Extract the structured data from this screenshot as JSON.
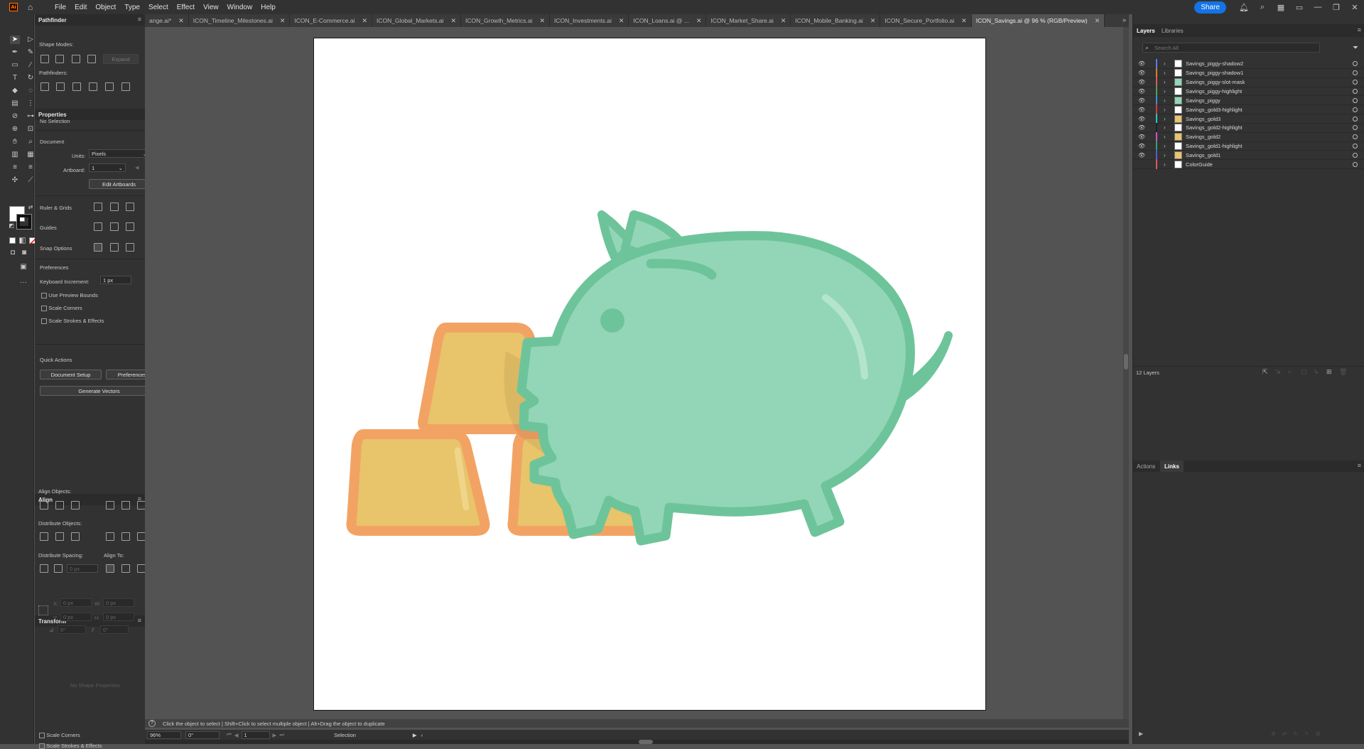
{
  "menubar": {
    "logo": "Ai",
    "items": [
      "File",
      "Edit",
      "Object",
      "Type",
      "Select",
      "Effect",
      "View",
      "Window",
      "Help"
    ],
    "share_label": "Share"
  },
  "tabs": [
    {
      "label": "ange.ai*",
      "active": false
    },
    {
      "label": "ICON_Timeline_Milestones.ai",
      "active": false
    },
    {
      "label": "ICON_E-Commerce.ai",
      "active": false
    },
    {
      "label": "ICON_Global_Markets.ai",
      "active": false
    },
    {
      "label": "ICON_Growth_Metrics.ai",
      "active": false
    },
    {
      "label": "ICON_Investments.ai",
      "active": false
    },
    {
      "label": "ICON_Loans.ai @ ...",
      "active": false
    },
    {
      "label": "ICON_Market_Share.ai",
      "active": false
    },
    {
      "label": "ICON_Mobile_Banking.ai",
      "active": false
    },
    {
      "label": "ICON_Secure_Portfolio.ai",
      "active": false
    },
    {
      "label": "ICON_Savings.ai @ 96 % (RGB/Preview)",
      "active": true
    }
  ],
  "pathfinder": {
    "title": "Pathfinder",
    "shape_modes_label": "Shape Modes:",
    "expand_label": "Expand",
    "pathfinders_label": "Pathfinders:"
  },
  "properties": {
    "title": "Properties",
    "selection": "No Selection",
    "document_label": "Document",
    "units_label": "Units:",
    "units_value": "Pixels",
    "artboard_label": "Artboard:",
    "artboard_value": "1",
    "edit_artboards_label": "Edit Artboards",
    "ruler_grids_label": "Ruler & Grids",
    "guides_label": "Guides",
    "snap_options_label": "Snap Options",
    "preferences_label": "Preferences",
    "keyboard_increment_label": "Keyboard Increment:",
    "keyboard_increment_value": "1 px",
    "use_preview_bounds": "Use Preview Bounds",
    "scale_corners": "Scale Corners",
    "scale_strokes": "Scale Strokes & Effects",
    "quick_actions_label": "Quick Actions",
    "document_setup_label": "Document Setup",
    "preferences_button_label": "Preferences",
    "generate_vectors_label": "Generate Vectors"
  },
  "align": {
    "title": "Align",
    "align_objects_label": "Align Objects:",
    "distribute_objects_label": "Distribute Objects:",
    "distribute_spacing_label": "Distribute Spacing:",
    "align_to_label": "Align To:",
    "spacing_value": "0 px"
  },
  "transform": {
    "title": "Transform",
    "x_label": "X:",
    "x_value": "0 px",
    "y_label": "Y:",
    "y_value": "0 px",
    "w_label": "W:",
    "w_value": "0 px",
    "h_label": "H:",
    "h_value": "0 px",
    "angle_value": "0°",
    "shear_value": "0°",
    "no_shape": "No Shape Properties"
  },
  "bottom_left": {
    "scale_corners": "Scale Corners",
    "scale_strokes": "Scale Strokes & Effects"
  },
  "layers_panel": {
    "tab_layers": "Layers",
    "tab_libraries": "Libraries",
    "search_placeholder": "Search All",
    "layers_count": "12 Layers",
    "layers": [
      {
        "name": "Savings_piggy-shadow2",
        "color": "#4f7fff",
        "thumb": "#ffffff"
      },
      {
        "name": "Savings_piggy-shadow1",
        "color": "#e07a2e",
        "thumb": "#ffffff"
      },
      {
        "name": "Savings_piggy-slot-mask",
        "color": "#d65b5b",
        "thumb": "#93d6b7"
      },
      {
        "name": "Savings_piggy-highlight",
        "color": "#4fa34f",
        "thumb": "#ffffff"
      },
      {
        "name": "Savings_piggy",
        "color": "#3a8fd6",
        "thumb": "#93d6b7"
      },
      {
        "name": "Savings_gold3-highlight",
        "color": "#d43b3b",
        "thumb": "#ffffff"
      },
      {
        "name": "Savings_gold3",
        "color": "#2fc2c2",
        "thumb": "#e8c46a"
      },
      {
        "name": "Savings_gold2-highlight",
        "color": "#222222",
        "thumb": "#ffffff"
      },
      {
        "name": "Savings_gold2",
        "color": "#d44fd4",
        "thumb": "#e8c46a"
      },
      {
        "name": "Savings_gold1-highlight",
        "color": "#2fa36f",
        "thumb": "#ffffff"
      },
      {
        "name": "Savings_gold1",
        "color": "#4f5fd6",
        "thumb": "#e8c46a"
      },
      {
        "name": "ColorGuide",
        "color": "#d65b5b",
        "thumb": "#ffffff"
      }
    ]
  },
  "actions_panel": {
    "tab_actions": "Actions",
    "tab_links": "Links"
  },
  "statusbar": {
    "hint": "Click the object to select  |  Shift+Click to select multiple object  |  Alt+Drag the object to duplicate"
  },
  "bottombar": {
    "zoom": "96%",
    "rotation": "0°",
    "artboard_nav": "1",
    "tool_name": "Selection"
  },
  "colors": {
    "gold_fill": "#e8c46a",
    "gold_stroke": "#f2a363",
    "piggy_fill": "#93d6b7",
    "piggy_stroke": "#6ec49a",
    "accent": "#1473e6"
  }
}
